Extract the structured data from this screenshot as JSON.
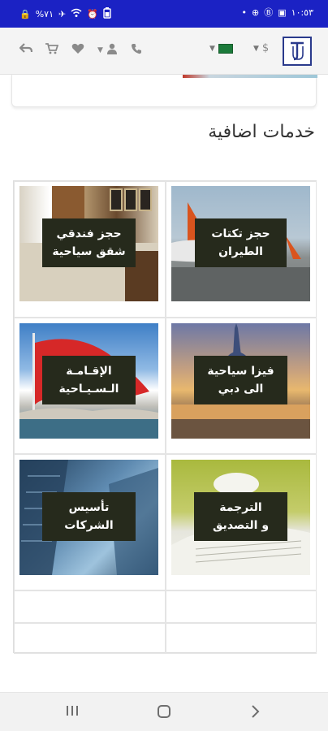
{
  "status_bar": {
    "left_items": [
      "🔒",
      "%٧١",
      "✈",
      "wifi-icon",
      "alarm-icon",
      "battery-icon"
    ],
    "time": "١٠:٥٣"
  },
  "nav": {
    "currency": "$",
    "icons": [
      "back-icon",
      "cart-icon",
      "heart-icon",
      "user-icon",
      "phone-icon"
    ]
  },
  "section": {
    "title": "خدمات اضافية"
  },
  "tiles": [
    {
      "line1": "حجز تكتات",
      "line2": "الطيران"
    },
    {
      "line1": "حجز فندقي",
      "line2": "شقق سياحية"
    },
    {
      "line1": "فيزا سياحية",
      "line2": "الى دبي"
    },
    {
      "line1": "الإقـامـة",
      "line2": "الـسـيـاحية"
    },
    {
      "line1": "الترجمة",
      "line2": "و التصديق"
    },
    {
      "line1": "تأسيس",
      "line2": "الشركات"
    }
  ],
  "colors": {
    "status_bar": "#1b22c4",
    "tile_label_bg": "#262a1c",
    "logo": "#2a3a8c"
  }
}
